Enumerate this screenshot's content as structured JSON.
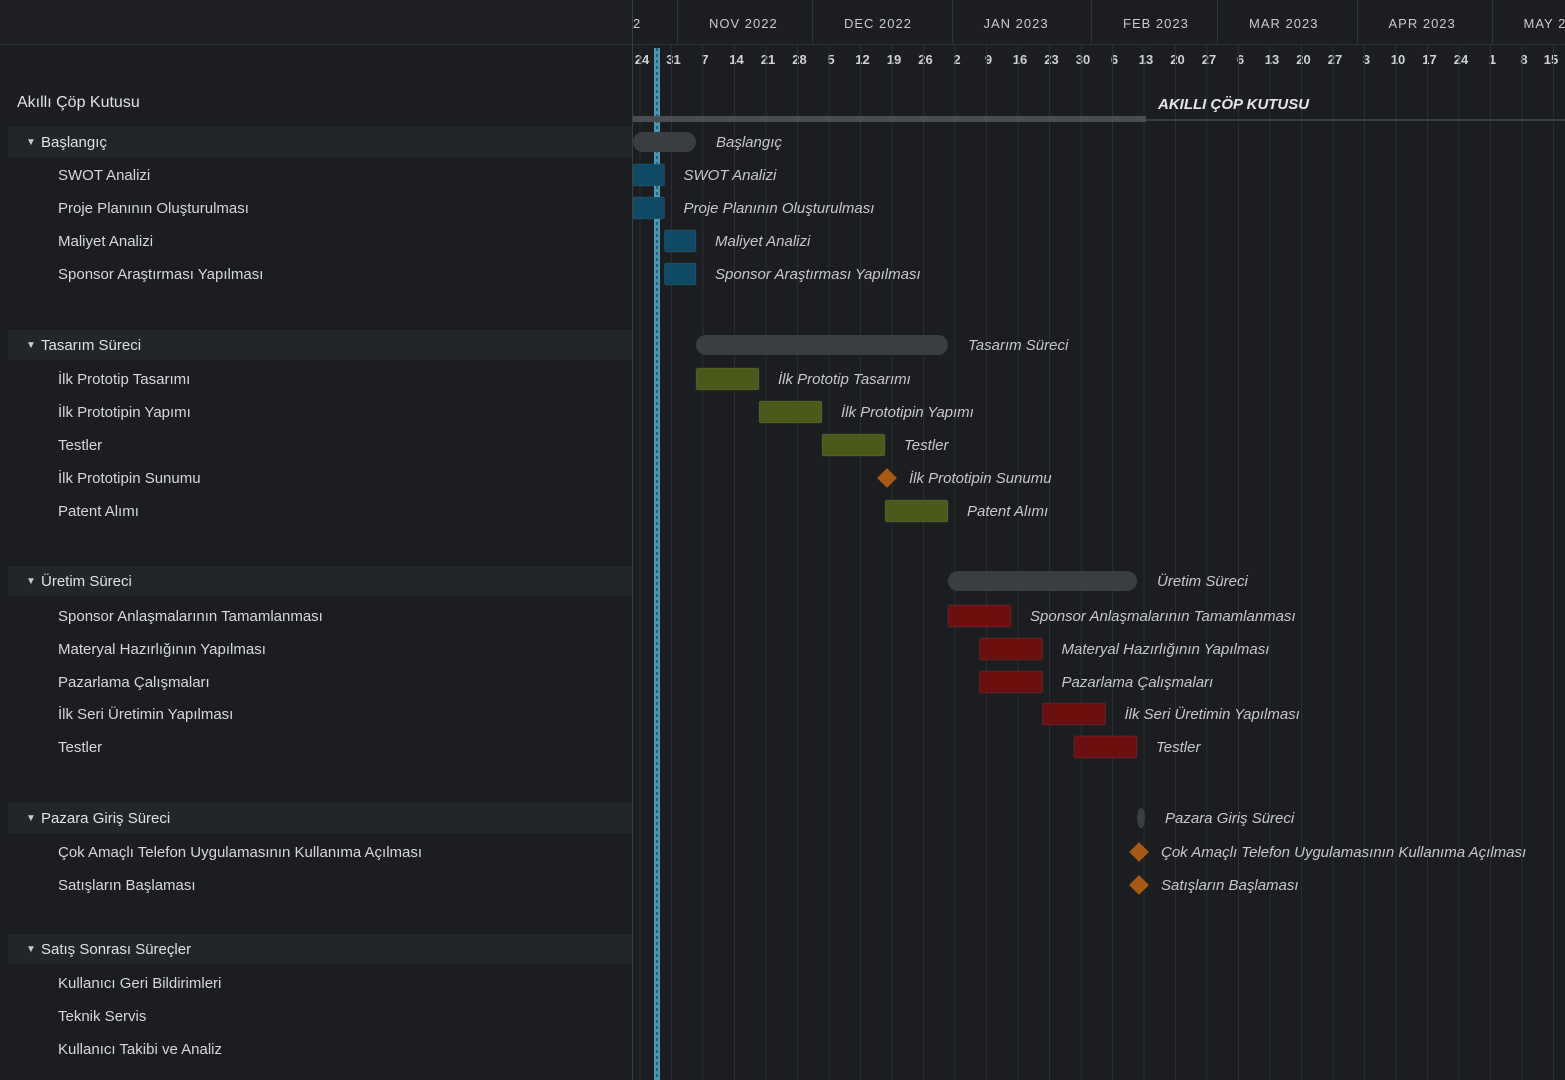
{
  "project": {
    "name": "Akıllı Çöp Kutusu",
    "bar_label": "AKILLI ÇÖP KUTUSU"
  },
  "timeline": {
    "months": [
      {
        "label": "2",
        "day": 0
      },
      {
        "label": "NOV 2022",
        "day": 8
      },
      {
        "label": "DEC 2022",
        "day": 38
      },
      {
        "label": "JAN 2023",
        "day": 69
      },
      {
        "label": "FEB 2023",
        "day": 100
      },
      {
        "label": "MAR 2023",
        "day": 128
      },
      {
        "label": "APR 2023",
        "day": 159
      },
      {
        "label": "MAY 2",
        "day": 189
      }
    ],
    "days": [
      {
        "label": "24",
        "day": 0
      },
      {
        "label": "31",
        "day": 7
      },
      {
        "label": "7",
        "day": 14
      },
      {
        "label": "14",
        "day": 21
      },
      {
        "label": "21",
        "day": 28
      },
      {
        "label": "28",
        "day": 35
      },
      {
        "label": "5",
        "day": 42
      },
      {
        "label": "12",
        "day": 49
      },
      {
        "label": "19",
        "day": 56
      },
      {
        "label": "26",
        "day": 63
      },
      {
        "label": "2",
        "day": 70
      },
      {
        "label": "9",
        "day": 77
      },
      {
        "label": "16",
        "day": 84
      },
      {
        "label": "23",
        "day": 91
      },
      {
        "label": "30",
        "day": 98
      },
      {
        "label": "6",
        "day": 105
      },
      {
        "label": "13",
        "day": 112
      },
      {
        "label": "20",
        "day": 119
      },
      {
        "label": "27",
        "day": 126
      },
      {
        "label": "6",
        "day": 133
      },
      {
        "label": "13",
        "day": 140
      },
      {
        "label": "20",
        "day": 147
      },
      {
        "label": "27",
        "day": 154
      },
      {
        "label": "3",
        "day": 161
      },
      {
        "label": "10",
        "day": 168
      },
      {
        "label": "17",
        "day": 175
      },
      {
        "label": "24",
        "day": 182
      },
      {
        "label": "1",
        "day": 189
      },
      {
        "label": "8",
        "day": 196
      },
      {
        "label": "15",
        "day": 203
      }
    ],
    "today_day": 2,
    "project_span": {
      "start": 0,
      "end": 112,
      "total_end": 210
    }
  },
  "colors": {
    "start": "#0e4a66",
    "design": "#4a5a1a",
    "production": "#6b0f0f",
    "milestone": "#a85a12",
    "summary": "#3a3d42",
    "today": "#4aa9c8"
  },
  "groups": [
    {
      "name": "Başlangıç",
      "key": "start",
      "summary": {
        "start": 0,
        "end": 14
      },
      "tasks": [
        {
          "name": "SWOT Analizi",
          "start": 0,
          "end": 7
        },
        {
          "name": "Proje Planının Oluşturulması",
          "start": 0,
          "end": 7
        },
        {
          "name": "Maliyet Analizi",
          "start": 7,
          "end": 14
        },
        {
          "name": "Sponsor Araştırması Yapılması",
          "start": 7,
          "end": 14
        }
      ]
    },
    {
      "name": "Tasarım Süreci",
      "key": "design",
      "summary": {
        "start": 14,
        "end": 70
      },
      "tasks": [
        {
          "name": "İlk Prototip Tasarımı",
          "start": 14,
          "end": 28
        },
        {
          "name": "İlk Prototipin Yapımı",
          "start": 28,
          "end": 42
        },
        {
          "name": "Testler",
          "start": 42,
          "end": 56
        },
        {
          "name": "İlk Prototipin Sunumu",
          "milestone": 56
        },
        {
          "name": "Patent Alımı",
          "start": 56,
          "end": 70
        }
      ]
    },
    {
      "name": "Üretim Süreci",
      "key": "production",
      "summary": {
        "start": 70,
        "end": 112
      },
      "tasks": [
        {
          "name": "Sponsor Anlaşmalarının Tamamlanması",
          "start": 70,
          "end": 84
        },
        {
          "name": "Materyal Hazırlığının Yapılması",
          "start": 77,
          "end": 91
        },
        {
          "name": "Pazarlama Çalışmaları",
          "start": 77,
          "end": 91
        },
        {
          "name": "İlk Seri Üretimin Yapılması",
          "start": 91,
          "end": 105
        },
        {
          "name": "Testler",
          "start": 98,
          "end": 112
        }
      ]
    },
    {
      "name": "Pazara Giriş Süreci",
      "key": "market",
      "summary": {
        "start": 112,
        "end": 113
      },
      "tasks": [
        {
          "name": "Çok Amaçlı Telefon Uygulamasının Kullanıma Açılması",
          "milestone": 112
        },
        {
          "name": "Satışların Başlaması",
          "milestone": 112
        }
      ]
    },
    {
      "name": "Satış Sonrası Süreçler",
      "key": "after",
      "tasks": [
        {
          "name": "Kullanıcı Geri Bildirimleri"
        },
        {
          "name": "Teknik Servis"
        },
        {
          "name": "Kullanıcı Takibi ve Analiz"
        }
      ]
    }
  ]
}
